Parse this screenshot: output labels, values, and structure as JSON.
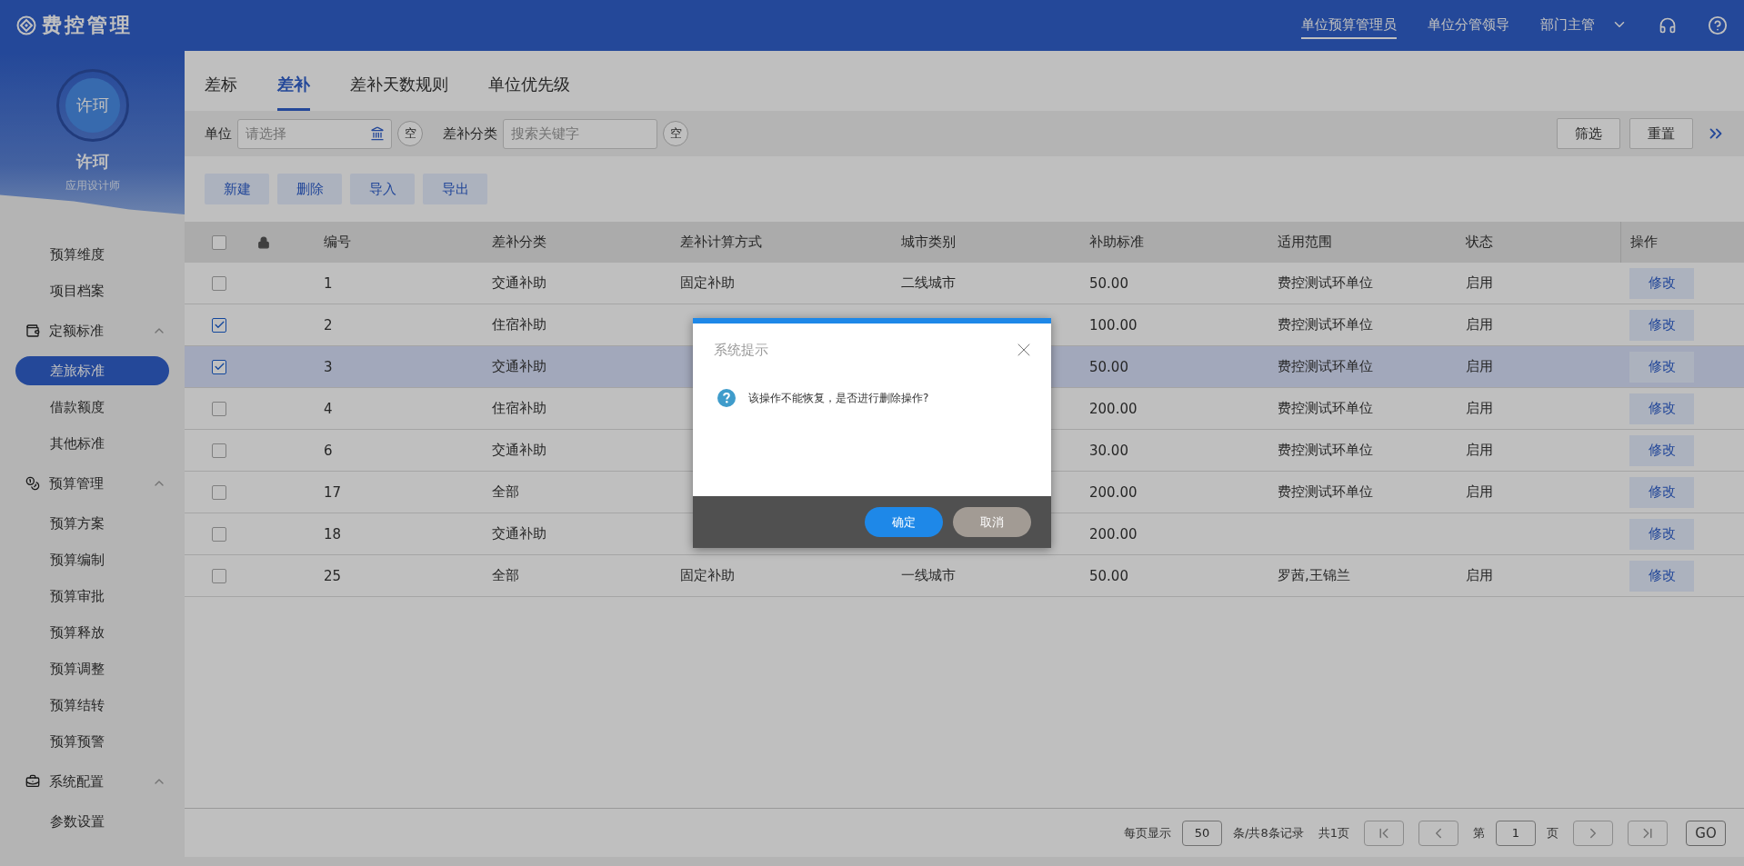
{
  "header": {
    "app_title": "费控管理",
    "roles": [
      {
        "label": "单位预算管理员",
        "selected": true,
        "dropdown": false
      },
      {
        "label": "单位分管领导",
        "selected": false,
        "dropdown": false
      },
      {
        "label": "部门主管",
        "selected": false,
        "dropdown": true
      }
    ]
  },
  "sidebar": {
    "user": {
      "avatar_text": "许珂",
      "name": "许珂",
      "role": "应用设计师"
    },
    "groups": [
      {
        "items": [
          {
            "label": "预算维度",
            "selected": false
          },
          {
            "label": "项目档案",
            "selected": false
          }
        ]
      },
      {
        "title": "定额标准",
        "expanded": true,
        "items": [
          {
            "label": "差旅标准",
            "selected": true
          },
          {
            "label": "借款额度",
            "selected": false
          },
          {
            "label": "其他标准",
            "selected": false
          }
        ]
      },
      {
        "title": "预算管理",
        "expanded": true,
        "items": [
          {
            "label": "预算方案",
            "selected": false
          },
          {
            "label": "预算编制",
            "selected": false
          },
          {
            "label": "预算审批",
            "selected": false
          },
          {
            "label": "预算释放",
            "selected": false
          },
          {
            "label": "预算调整",
            "selected": false
          },
          {
            "label": "预算结转",
            "selected": false
          },
          {
            "label": "预算预警",
            "selected": false
          }
        ]
      },
      {
        "title": "系统配置",
        "expanded": true,
        "items": [
          {
            "label": "参数设置",
            "selected": false
          }
        ]
      }
    ]
  },
  "tabs": [
    {
      "label": "差标",
      "selected": false
    },
    {
      "label": "差补",
      "selected": true
    },
    {
      "label": "差补天数规则",
      "selected": false
    },
    {
      "label": "单位优先级",
      "selected": false
    }
  ],
  "filters": {
    "fields": [
      {
        "label": "单位",
        "placeholder": "请选择",
        "picker": true,
        "clear": "空"
      },
      {
        "label": "差补分类",
        "placeholder": "搜索关键字",
        "picker": false,
        "clear": "空"
      }
    ],
    "buttons": [
      "筛选",
      "重置"
    ]
  },
  "actions": [
    "新建",
    "删除",
    "导入",
    "导出"
  ],
  "table": {
    "header_checked": false,
    "columns": [
      "编号",
      "差补分类",
      "差补计算方式",
      "城市类别",
      "补助标准",
      "适用范围",
      "状态",
      "操作"
    ],
    "rows": [
      {
        "checked": false,
        "selected": false,
        "no": "1",
        "category": "交通补助",
        "method": "固定补助",
        "city": "二线城市",
        "amount": "50.00",
        "scope": "费控测试环单位",
        "status": "启用",
        "action": "修改"
      },
      {
        "checked": true,
        "selected": false,
        "no": "2",
        "category": "住宿补助",
        "amount": "100.00",
        "scope": "费控测试环单位",
        "status": "启用",
        "action": "修改"
      },
      {
        "checked": true,
        "selected": true,
        "no": "3",
        "category": "交通补助",
        "amount": "50.00",
        "scope": "费控测试环单位",
        "status": "启用",
        "action": "修改"
      },
      {
        "checked": false,
        "selected": false,
        "no": "4",
        "category": "住宿补助",
        "amount": "200.00",
        "scope": "费控测试环单位",
        "status": "启用",
        "action": "修改"
      },
      {
        "checked": false,
        "selected": false,
        "no": "6",
        "category": "交通补助",
        "amount": "30.00",
        "scope": "费控测试环单位",
        "status": "启用",
        "action": "修改"
      },
      {
        "checked": false,
        "selected": false,
        "no": "17",
        "category": "全部",
        "amount": "200.00",
        "scope": "费控测试环单位",
        "status": "启用",
        "action": "修改"
      },
      {
        "checked": false,
        "selected": false,
        "no": "18",
        "category": "交通补助",
        "amount": "200.00",
        "action": "修改"
      },
      {
        "checked": false,
        "selected": false,
        "no": "25",
        "category": "全部",
        "method": "固定补助",
        "city": "一线城市",
        "amount": "50.00",
        "scope": "罗茜,王锦兰",
        "status": "启用",
        "action": "修改"
      }
    ]
  },
  "pagination": {
    "per_page_label": "每页显示",
    "per_page": "50",
    "records": "条/共8条记录",
    "pages": "共1页",
    "page_prefix": "第",
    "page": "1",
    "page_suffix": "页",
    "go": "GO"
  },
  "dialog": {
    "title": "系统提示",
    "message": "该操作不能恢复，是否进行删除操作?",
    "buttons": [
      {
        "label": "确定",
        "kind": "primary"
      },
      {
        "label": "取消",
        "kind": "secondary"
      }
    ]
  }
}
